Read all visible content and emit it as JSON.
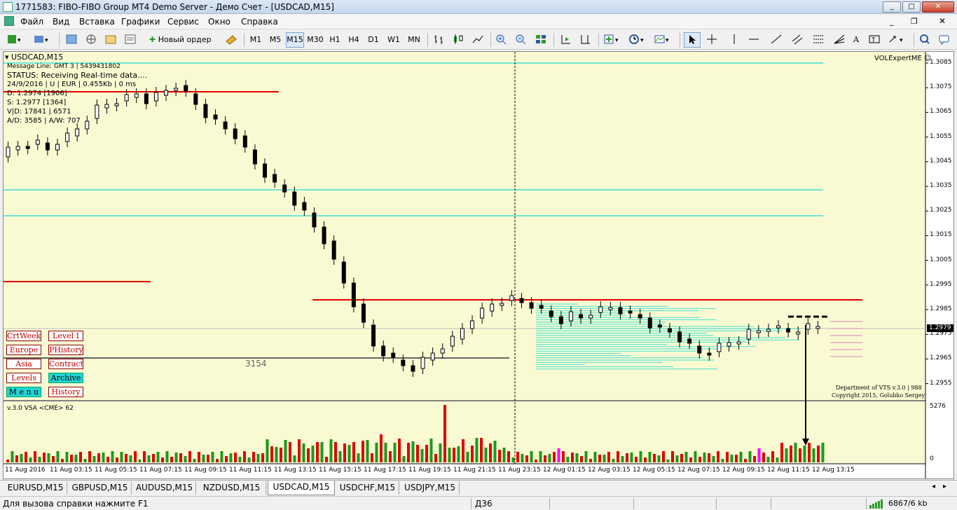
{
  "window": {
    "title": "1771583: FIBO-FIBO Group MT4 Demo Server - Демо Счет - [USDCAD,M15]",
    "min_label": "0",
    "max_label": "1",
    "close_label": "r"
  },
  "menu": [
    "Файл",
    "Вид",
    "Вставка",
    "Графики",
    "Сервис",
    "Окно",
    "Справка"
  ],
  "toolbar": {
    "new_order_label": "Новый ордер",
    "timeframes": [
      "M1",
      "M5",
      "M15",
      "M30",
      "H1",
      "H4",
      "D1",
      "W1",
      "MN"
    ],
    "active_timeframe": "M15"
  },
  "chart": {
    "symbol_title": "USDCAD,M15",
    "info_lines": [
      "Message Line: GMT 3 | 5439431802",
      "STATUS:  Receiving Real-time data....",
      "24/9/2016 | U | EUR | 0.455Kb | 0 ms",
      "D: 1.2974  [1906]",
      "S: 1.2977  [1364]",
      "V|D: 17841 | 6571",
      "A/D: 3585 | A/W: 707"
    ],
    "expert_label": "VOLExpertME",
    "price_labels": [
      "1.3085",
      "1.3075",
      "1.3065",
      "1.3055",
      "1.3045",
      "1.3035",
      "1.3025",
      "1.3015",
      "1.3005",
      "1.2995",
      "1.2985",
      "1.2975",
      "1.2965",
      "1.2955"
    ],
    "current_price": "1.2979",
    "level_number": "3154",
    "buttons": [
      {
        "label": "CrtWeek",
        "style": "white"
      },
      {
        "label": "Level I",
        "style": "white"
      },
      {
        "label": "Europe",
        "style": "white"
      },
      {
        "label": "PHistory",
        "style": "white"
      },
      {
        "label": "Asia",
        "style": "white"
      },
      {
        "label": "Contract",
        "style": "white"
      },
      {
        "label": "Levels",
        "style": "white"
      },
      {
        "label": "Archive",
        "style": "cyan"
      },
      {
        "label": "M e n u",
        "style": "cyan"
      },
      {
        "label": "History",
        "style": "white"
      }
    ],
    "copyright_lines": [
      "Department of VTS  v.3.0 | 988",
      "Copyright 2015, Golubko Sergey"
    ],
    "indicator_title": "v.3.0 VSA <CME> 62",
    "indicator_scale_top": "5276",
    "indicator_scale_bottom": "0",
    "time_labels": [
      "11 Aug 2016",
      "11 Aug 03:15",
      "11 Aug 05:15",
      "11 Aug 07:15",
      "11 Aug 09:15",
      "11 Aug 11:15",
      "11 Aug 13:15",
      "11 Aug 15:15",
      "11 Aug 17:15",
      "11 Aug 19:15",
      "11 Aug 21:15",
      "11 Aug 23:15",
      "12 Aug 01:15",
      "12 Aug 03:15",
      "12 Aug 05:15",
      "12 Aug 07:15",
      "12 Aug 09:15",
      "12 Aug 11:15",
      "12 Aug 13:15"
    ],
    "colors": {
      "background": "#fafad2",
      "candle": "#000000",
      "resistance": "#e00000",
      "level_line": "#40e0d0",
      "volume_up": "#1a9a1a",
      "volume_down": "#e00000",
      "volume_climax": "#ff00ff"
    }
  },
  "tabs": [
    "EURUSD,M15",
    "GBPUSD,M15",
    "AUDUSD,M15",
    "NZDUSD,M15",
    "USDCAD,M15",
    "USDCHF,M15",
    "USDJPY,M15"
  ],
  "active_tab": "USDCAD,M15",
  "status": {
    "help_text": "Для вызова справки нажмите F1",
    "profile": "Д36",
    "traffic": "6867/6 kb"
  }
}
